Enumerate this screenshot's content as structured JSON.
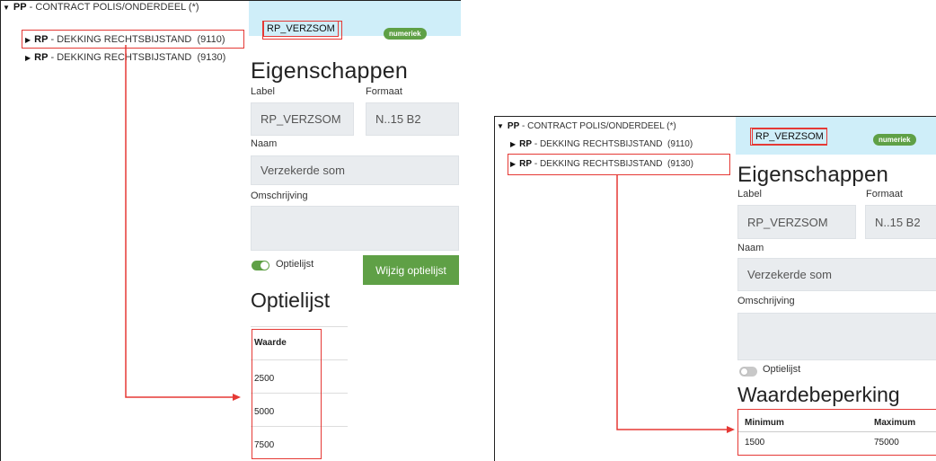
{
  "left": {
    "tree": {
      "root": {
        "code": "PP",
        "label": " - CONTRACT POLIS/ONDERDEEL (*)"
      },
      "items": [
        {
          "code": "RP",
          "label": " - DEKKING RECHTSBIJSTAND",
          "number": "(9110)"
        },
        {
          "code": "RP",
          "label": " - DEKKING RECHTSBIJSTAND",
          "number": "(9130)"
        }
      ]
    },
    "header": {
      "label": "RP_VERZSOM",
      "badge": "numeriek"
    },
    "heading": "Eigenschappen",
    "fields": {
      "label_caption": "Label",
      "label_value": "RP_VERZSOM",
      "format_caption": "Formaat",
      "format_value": "N..15 B2",
      "name_caption": "Naam",
      "name_value": "Verzekerde som",
      "desc_caption": "Omschrijving",
      "desc_value": ""
    },
    "toggle": {
      "label": "Optielijst",
      "on": true
    },
    "button": "Wijzig optielijst",
    "section": "Optielijst",
    "table": {
      "header": "Waarde",
      "rows": [
        "2500",
        "5000",
        "7500"
      ]
    }
  },
  "right": {
    "tree": {
      "root": {
        "code": "PP",
        "label": " - CONTRACT POLIS/ONDERDEEL (*)"
      },
      "items": [
        {
          "code": "RP",
          "label": " - DEKKING RECHTSBIJSTAND",
          "number": "(9110)"
        },
        {
          "code": "RP",
          "label": " - DEKKING RECHTSBIJSTAND",
          "number": "(9130)"
        }
      ]
    },
    "header": {
      "label": "RP_VERZSOM",
      "badge": "numeriek"
    },
    "heading": "Eigenschappen",
    "fields": {
      "label_caption": "Label",
      "label_value": "RP_VERZSOM",
      "format_caption": "Formaat",
      "format_value": "N..15 B2",
      "name_caption": "Naam",
      "name_value": "Verzekerde som",
      "desc_caption": "Omschrijving",
      "desc_value": ""
    },
    "toggle": {
      "label": "Optielijst",
      "on": false
    },
    "section": "Waardebeperking",
    "table": {
      "headers": [
        "Minimum",
        "Maximum"
      ],
      "row": [
        "1500",
        "75000"
      ]
    }
  },
  "colors": {
    "accent_green": "#5fa046",
    "header_bg": "#cfeef9",
    "highlight_red": "#e53935"
  }
}
